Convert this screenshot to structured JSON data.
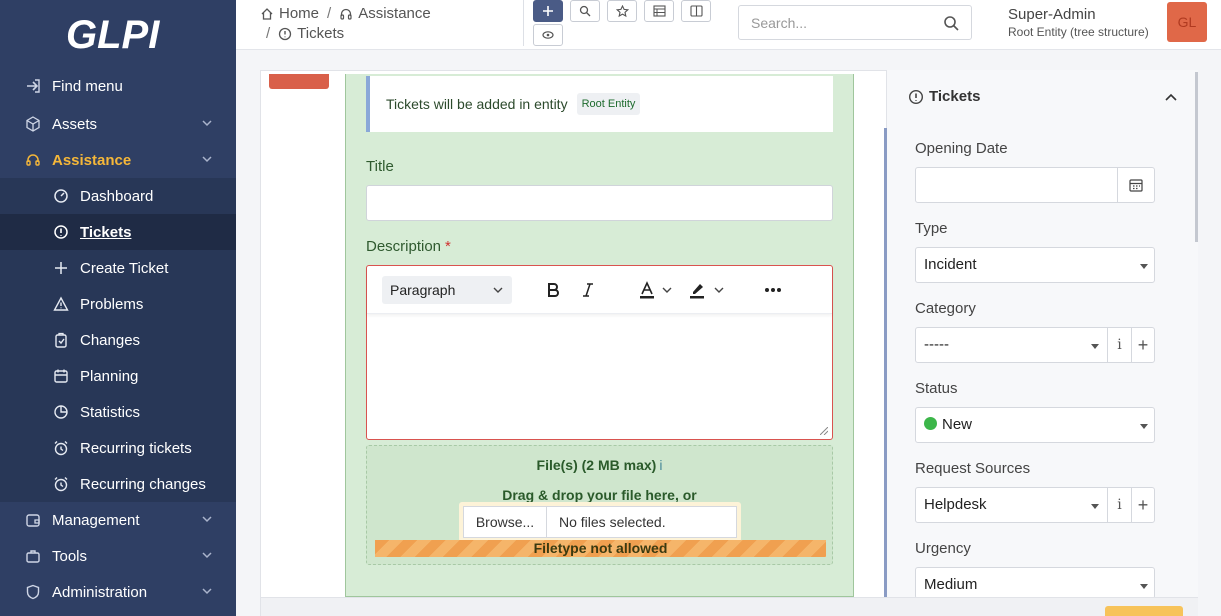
{
  "app": {
    "logo_text": "GLPI"
  },
  "sidebar": {
    "find_menu": "Find menu",
    "assets": "Assets",
    "assistance": "Assistance",
    "items": [
      {
        "label": "Dashboard",
        "icon": "gauge-icon"
      },
      {
        "label": "Tickets",
        "icon": "ticket-icon"
      },
      {
        "label": "Create Ticket",
        "icon": "plus-icon"
      },
      {
        "label": "Problems",
        "icon": "warning-icon"
      },
      {
        "label": "Changes",
        "icon": "clipboard-check-icon"
      },
      {
        "label": "Planning",
        "icon": "calendar-icon"
      },
      {
        "label": "Statistics",
        "icon": "pie-chart-icon"
      },
      {
        "label": "Recurring tickets",
        "icon": "alarm-icon"
      },
      {
        "label": "Recurring changes",
        "icon": "alarm-icon"
      }
    ],
    "management": "Management",
    "tools": "Tools",
    "administration": "Administration"
  },
  "header": {
    "crumb_home": "Home",
    "crumb_assistance": "Assistance",
    "crumb_tickets": "Tickets",
    "search_placeholder": "Search...",
    "user_name": "Super-Admin",
    "user_entity": "Root Entity (tree structure)",
    "avatar_initials": "GL"
  },
  "form": {
    "alert_text": "Tickets will be added in entity",
    "entity_badge": "Root Entity",
    "title_label": "Title",
    "title_value": "",
    "description_label": "Description",
    "required_mark": "*",
    "paragraph_style": "Paragraph",
    "files_label": "File(s) (2 MB max)",
    "files_info": "i",
    "drag_text": "Drag & drop your file here, or",
    "browse_label": "Browse...",
    "no_files": "No files selected.",
    "filetype_error": "Filetype not allowed"
  },
  "right_panel": {
    "title": "Tickets",
    "opening_date_label": "Opening Date",
    "opening_date_value": "",
    "type_label": "Type",
    "type_value": "Incident",
    "category_label": "Category",
    "category_value": "-----",
    "status_label": "Status",
    "status_value": "New",
    "request_source_label": "Request Sources",
    "request_source_value": "Helpdesk",
    "urgency_label": "Urgency",
    "urgency_value": "Medium",
    "info_btn": "i",
    "add_btn": "+"
  },
  "colors": {
    "sidebar_bg": "#2f3f64",
    "active_accent": "#f5b739",
    "form_bg": "#d7ecd6",
    "status_new": "#3cb64a",
    "avatar_bg": "#e06848"
  }
}
